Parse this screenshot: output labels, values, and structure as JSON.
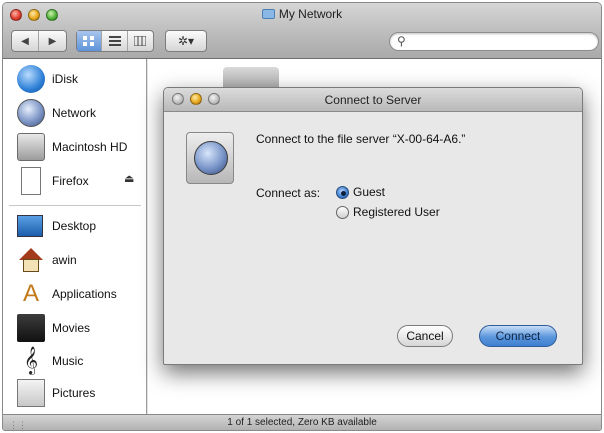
{
  "window": {
    "title": "My Network"
  },
  "toolbar": {
    "back_glyph": "◀",
    "forward_glyph": "▶",
    "view_icons": [
      "icon-view",
      "list-view",
      "column-view"
    ],
    "action_glyph": "✲▾",
    "search_value": ""
  },
  "sidebar": {
    "devices": [
      {
        "label": "iDisk",
        "icon": "idisk-icon"
      },
      {
        "label": "Network",
        "icon": "network-icon"
      },
      {
        "label": "Macintosh HD",
        "icon": "hard-disk-icon"
      },
      {
        "label": "Firefox",
        "icon": "disk-image-icon",
        "eject": "⏏"
      }
    ],
    "places": [
      {
        "label": "Desktop",
        "icon": "desktop-icon"
      },
      {
        "label": "awin",
        "icon": "home-icon"
      },
      {
        "label": "Applications",
        "icon": "applications-icon"
      },
      {
        "label": "Movies",
        "icon": "movies-icon"
      },
      {
        "label": "Music",
        "icon": "music-icon"
      },
      {
        "label": "Pictures",
        "icon": "pictures-icon"
      }
    ]
  },
  "status": {
    "text": "1 of 1 selected, Zero KB available"
  },
  "dialog": {
    "title": "Connect to Server",
    "message": "Connect to the file server “X-00-64-A6.”",
    "connect_as_label": "Connect as:",
    "options": [
      {
        "label": "Guest",
        "selected": true
      },
      {
        "label": "Registered User",
        "selected": false
      }
    ],
    "cancel_label": "Cancel",
    "connect_label": "Connect"
  },
  "colors": {
    "accent": "#3f7fcf",
    "window_chrome": "#bcbcbc"
  }
}
